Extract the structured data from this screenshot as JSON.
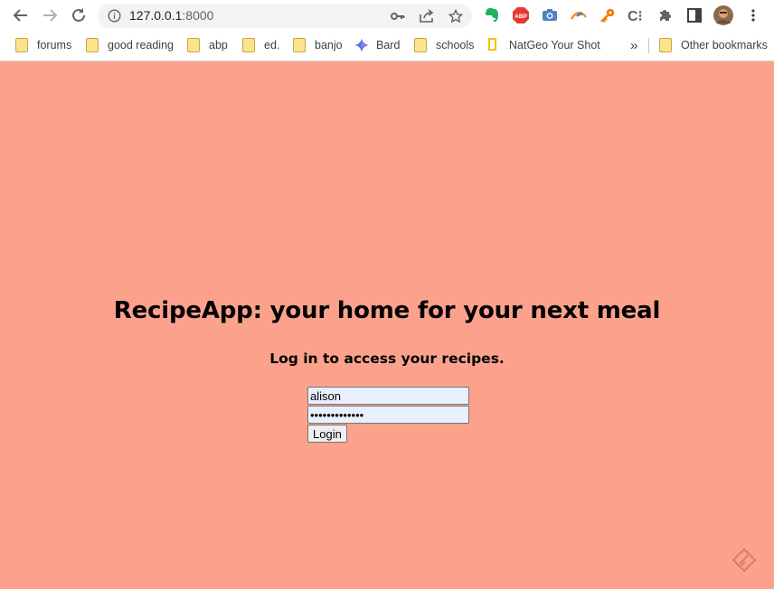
{
  "browser": {
    "url_host": "127.0.0.1",
    "url_port": ":8000",
    "bookmarks": [
      {
        "label": "forums",
        "icon": "folder-icon"
      },
      {
        "label": "good reading",
        "icon": "folder-icon"
      },
      {
        "label": "abp",
        "icon": "folder-icon"
      },
      {
        "label": "ed.",
        "icon": "folder-icon"
      },
      {
        "label": "banjo",
        "icon": "folder-icon"
      },
      {
        "label": "Bard",
        "icon": "sparkle-icon"
      },
      {
        "label": "schools",
        "icon": "folder-icon"
      },
      {
        "label": "NatGeo Your Shot",
        "icon": "natgeo-icon"
      }
    ],
    "overflow_label": "»",
    "other_bookmarks": "Other bookmarks",
    "extensions": [
      "evernote-icon",
      "adblock-icon",
      "camera-icon",
      "bird-icon",
      "key-icon",
      "code-icon",
      "puzzle-icon",
      "sidepanel-icon",
      "avatar",
      "menu-icon"
    ],
    "extension_labels": {
      "adblock": "ABP",
      "code": "C⁝"
    }
  },
  "page": {
    "background": "#fca28c",
    "title": "RecipeApp: your home for your next meal",
    "subtitle": "Log in to access your recipes.",
    "username_value": "alison",
    "password_value": "•••••••••••••",
    "login_label": "Login"
  }
}
